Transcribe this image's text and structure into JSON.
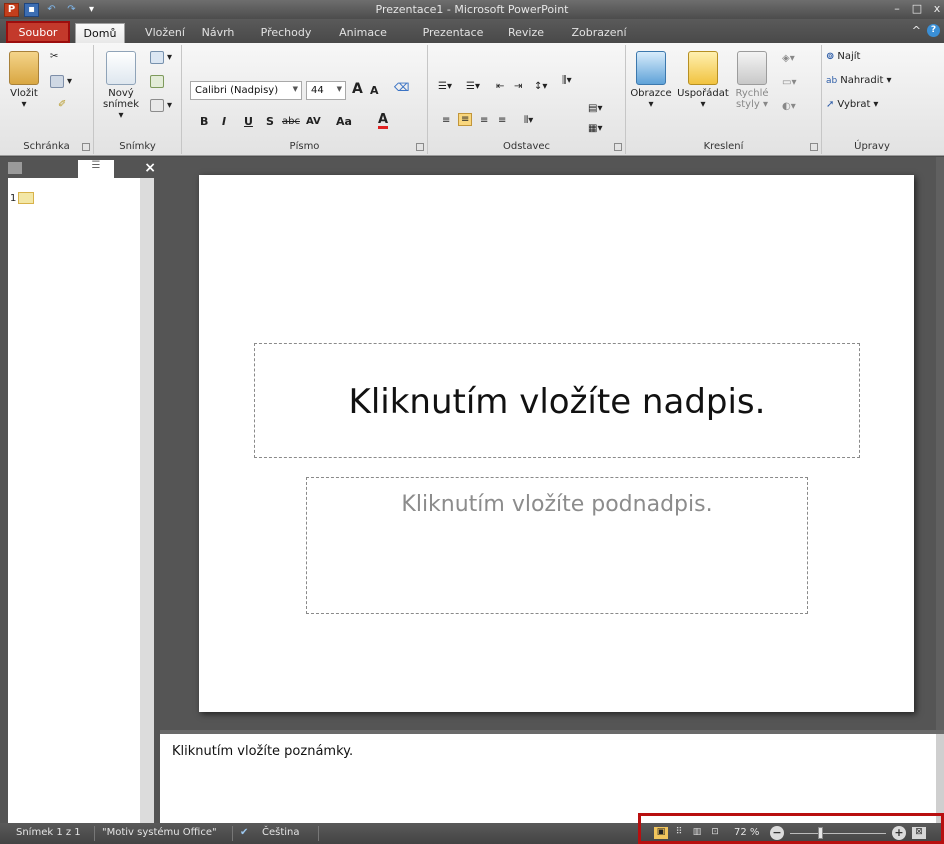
{
  "window": {
    "title": "Prezentace1 - Microsoft PowerPoint",
    "app_icon": "P",
    "minimize": "–",
    "restore": "□",
    "close": "x"
  },
  "qat": {
    "icons": [
      "powerpoint-icon",
      "save-icon",
      "undo-icon",
      "redo-icon",
      "customize-icon"
    ]
  },
  "tabs": {
    "file": "Soubor",
    "items": [
      "Domů",
      "Vložení",
      "Návrh",
      "Přechody",
      "Animace",
      "Prezentace",
      "Revize",
      "Zobrazení"
    ],
    "active": "Domů"
  },
  "ribbon": {
    "clipboard": {
      "label": "Schránka",
      "paste": "Vložit"
    },
    "slides": {
      "label": "Snímky",
      "new_slide_line1": "Nový",
      "new_slide_line2": "snímek"
    },
    "font": {
      "label": "Písmo",
      "font_name": "Calibri (Nadpisy)",
      "font_size": "44",
      "grow": "A",
      "shrink": "A",
      "bold": "B",
      "italic": "I",
      "underline": "U",
      "shadow": "S",
      "strike": "abc",
      "spacing": "AV",
      "case": "Aa",
      "color": "A"
    },
    "paragraph": {
      "label": "Odstavec"
    },
    "drawing": {
      "label": "Kreslení",
      "shapes": "Obrazce",
      "arrange": "Uspořádat",
      "quick_styles_line1": "Rychlé",
      "quick_styles_line2": "styly"
    },
    "editing": {
      "label": "Úpravy",
      "find": "Najít",
      "replace": "Nahradit",
      "select": "Vybrat"
    }
  },
  "left_panel": {
    "slide_number": "1"
  },
  "slide": {
    "title_placeholder": "Kliknutím vložíte nadpis.",
    "subtitle_placeholder": "Kliknutím vložíte podnadpis."
  },
  "notes": {
    "placeholder": "Kliknutím vložíte poznámky."
  },
  "status_bar": {
    "slide_info": "Snímek 1 z 1",
    "theme": "\"Motiv systému Office\"",
    "language": "Čeština",
    "zoom": "72 %",
    "zoom_level": 0.72
  },
  "colors": {
    "file_tab": "#c3392b",
    "highlight_border": "#b80f0f",
    "title_bar": "#5a5a5a"
  }
}
